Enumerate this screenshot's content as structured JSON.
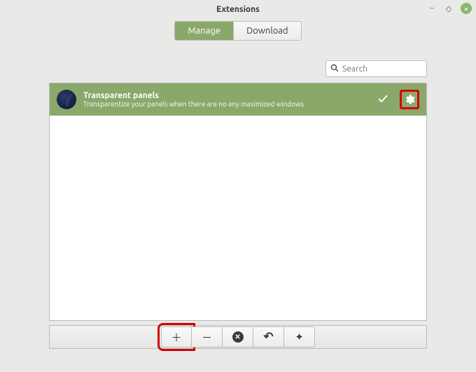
{
  "window": {
    "title": "Extensions"
  },
  "tabs": {
    "manage": "Manage",
    "download": "Download"
  },
  "search": {
    "placeholder": "Search"
  },
  "extension": {
    "title": "Transparent panels",
    "description": "Transparentize your panels when there are no any maximized windows"
  },
  "toolbar": {
    "add": "＋",
    "remove": "－",
    "delete": "✕",
    "undo": "↶",
    "promote": "✦"
  }
}
